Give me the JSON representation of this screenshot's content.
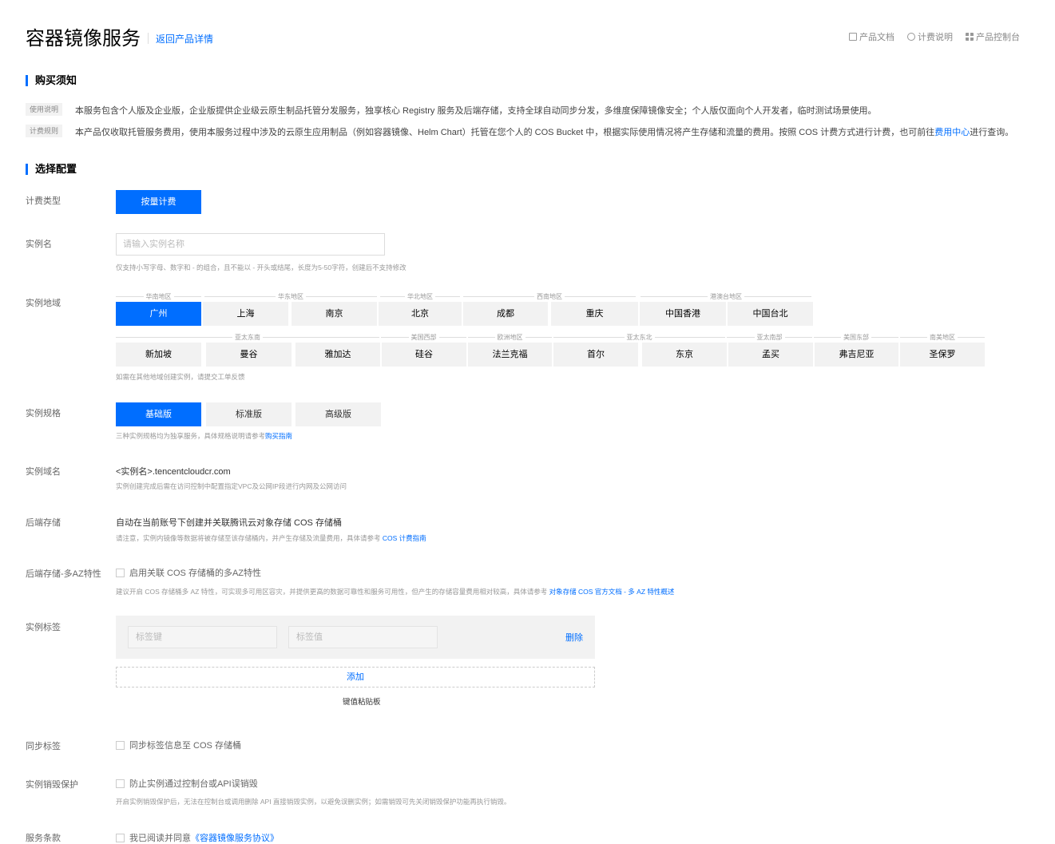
{
  "header": {
    "title": "容器镜像服务",
    "back_link": "返回产品详情",
    "links": [
      {
        "icon": "document-icon",
        "label": "产品文档"
      },
      {
        "icon": "info-icon",
        "label": "计费说明"
      },
      {
        "icon": "grid-icon",
        "label": "产品控制台"
      }
    ]
  },
  "notice": {
    "title": "购买须知",
    "items": [
      {
        "tag": "使用说明",
        "text": "本服务包含个人版及企业版，企业版提供企业级云原生制品托管分发服务，独享核心 Registry 服务及后端存储，支持全球自动同步分发，多维度保障镜像安全；个人版仅面向个人开发者，临时测试场景使用。"
      },
      {
        "tag": "计费规则",
        "text": "本产品仅收取托管服务费用，使用本服务过程中涉及的云原生应用制品（例如容器镜像、Helm Chart）托管在您个人的 COS Bucket 中，根据实际使用情况将产生存储和流量的费用。按照 COS 计费方式进行计费，也可前往",
        "link": "费用中心",
        "suffix": "进行查询。"
      }
    ]
  },
  "config": {
    "title": "选择配置",
    "billing": {
      "label": "计费类型",
      "option": "按量计费"
    },
    "instance_name": {
      "label": "实例名",
      "placeholder": "请输入实例名称",
      "hint": "仅支持小写字母、数字和 - 的组合，且不能以 - 开头或结尾，长度为5-50字符，创建后不支持修改"
    },
    "region": {
      "label": "实例地域",
      "row1_groups": [
        "华南地区",
        "华东地区",
        "华北地区",
        "西南地区",
        "港澳台地区"
      ],
      "row1": [
        "广州",
        "上海",
        "南京",
        "北京",
        "成都",
        "重庆",
        "中国香港",
        "中国台北"
      ],
      "row2_groups": [
        "亚太东南",
        "美国西部",
        "欧洲地区",
        "亚太东北",
        "亚太南部",
        "美国东部",
        "南美地区"
      ],
      "row2": [
        "新加坡",
        "曼谷",
        "雅加达",
        "硅谷",
        "法兰克福",
        "首尔",
        "东京",
        "孟买",
        "弗吉尼亚",
        "圣保罗"
      ],
      "selected": "广州",
      "hint": "如需在其他地域创建实例，请提交工单反馈"
    },
    "spec": {
      "label": "实例规格",
      "options": [
        "基础版",
        "标准版",
        "高级版"
      ],
      "selected": "基础版",
      "hint": "三种实例规格均为独享服务，具体规格说明请参考",
      "hint_link": "购买指南"
    },
    "domain": {
      "label": "实例域名",
      "value": "<实例名>.tencentcloudcr.com",
      "hint": "实例创建完成后需在访问控制中配置指定VPC及公网IP段进行内网及公网访问"
    },
    "storage": {
      "label": "后端存储",
      "value": "自动在当前账号下创建并关联腾讯云对象存储 COS 存储桶",
      "hint": "请注意，实例内镜像等数据将被存储至该存储桶内，并产生存储及流量费用，具体请参考",
      "hint_link": "COS 计费指南"
    },
    "multi_az": {
      "label": "后端存储-多AZ特性",
      "checkbox": "启用关联 COS 存储桶的多AZ特性",
      "hint": "建议开启 COS 存储桶多 AZ 特性，可实现多可用区容灾，并提供更高的数据可靠性和服务可用性，但产生的存储容量费用相对较高，具体请参考",
      "hint_link": "对象存储 COS 官方文档 - 多 AZ 特性概述"
    },
    "tags": {
      "label": "实例标签",
      "key_placeholder": "标签键",
      "value_placeholder": "标签值",
      "delete": "删除",
      "add": "添加",
      "paste": "键值粘贴板"
    },
    "sync_tags": {
      "label": "同步标签",
      "checkbox": "同步标签信息至 COS 存储桶"
    },
    "destroy_protect": {
      "label": "实例销毁保护",
      "checkbox": "防止实例通过控制台或API误销毁",
      "hint": "开启实例销毁保护后，无法在控制台或调用删除 API 直接销毁实例，以避免误删实例；如需销毁可先关闭销毁保护功能再执行销毁。"
    },
    "terms": {
      "label": "服务条款",
      "checkbox": "我已阅读并同意",
      "link": "《容器镜像服务协议》"
    }
  }
}
